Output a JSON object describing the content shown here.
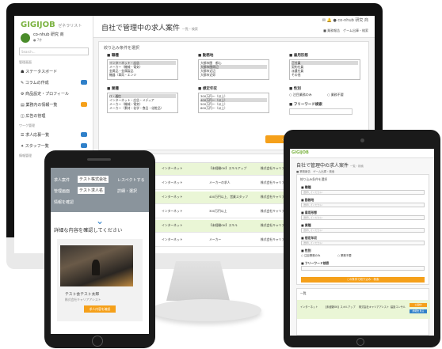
{
  "desktop": {
    "logo": "GIGIJOB",
    "logo_sub": "ゼネラリスト",
    "user_name": "co-nhub 研究 商",
    "user_sub": "● 7件",
    "search_placeholder": "Search...",
    "side_group_main": "管理画面",
    "side_group_work": "ワーク管理",
    "side_group_info": "情報管理",
    "sidebar_items": [
      {
        "label": "ステータスボード",
        "badge": ""
      },
      {
        "label": "コラムの作成",
        "badge": "blue"
      },
      {
        "label": "商品設定・プロフィール",
        "badge": ""
      },
      {
        "label": "業務内の情報一覧",
        "badge": "orange"
      },
      {
        "label": "広告の管理",
        "badge": ""
      },
      {
        "label": "求人応募一覧",
        "badge": "blue"
      },
      {
        "label": "スタッフ一覧",
        "badge": "blue"
      }
    ],
    "header_title": "自社で管理中の求人案件",
    "header_title_small": "一覧・検索",
    "header_icons": "✉ 🔔 ● co-nhub 研究 商",
    "header_right": "■ 業務報告　ゲーム出庫・検索",
    "panel_title": "絞り込み条件を選択",
    "filters": {
      "f1_label": "■ 職種",
      "f1_items": [
        "インターネット・広告",
        "メーカー（機械・電気）",
        "金属品・金属製品",
        "機器（車両・エンジ"
      ],
      "f2_label": "■ 勤務地",
      "f2_items": [
        "大都市圏　都心",
        "大都市圏周辺",
        "大都市近辺",
        "大都市近郊"
      ],
      "f3_label": "■ 雇用形態",
      "f3_items": [
        "正社員",
        "契約社員",
        "派遣社員",
        "その他"
      ],
      "f4_label": "■ 業種",
      "f4_items": [
        "IT・通信",
        "インターネット・広告・メディア",
        "メーカー（機械・電気）",
        "メーカー（素材・化学・食品・化粧品）"
      ],
      "f5_label": "■ 想定年収",
      "f5_items": [
        "300万円～（以上）",
        "400万円～（以上）",
        "500万円～（以上）",
        "600万円～（以上）"
      ],
      "f6_label": "■ 性別",
      "radio_a": "○ 注目業務のみ",
      "radio_b": "○ 業務不要",
      "freeword_label": "■ フリーワード検索",
      "search_button": "この条件で絞り込み・検索"
    },
    "results_header": "一覧",
    "rows": [
      {
        "c1": "インターネット",
        "c2": "【未経験OK】スキルアップ",
        "c3": "株式会社キャリアアシスト",
        "c4": "建設コンサル",
        "btn": "公開中"
      },
      {
        "c1": "インターネット",
        "c2": "メーカーの求人",
        "c3": "株式会社キャリアアシスト",
        "c4": "企業",
        "btn": "公開中"
      },
      {
        "c1": "インターネット",
        "c2": "400万円以上、営業スタッフ",
        "c3": "株式会社キャリアアシスト",
        "c4": "IT系",
        "btn": "公開中"
      },
      {
        "c1": "インターネット",
        "c2": "300万円以上",
        "c3": "株式会社キャリアアシスト",
        "c4": "販売スタッフ",
        "btn": "公開中"
      },
      {
        "c1": "インターネット",
        "c2": "【未経験OK】スキル",
        "c3": "株式会社キャリアアシスト",
        "c4": "建設コンサル",
        "btn": "公開中"
      },
      {
        "c1": "インターネット",
        "c2": "メーカー",
        "c3": "株式会社キャリアアシスト",
        "c4": "企業",
        "btn": "公開中"
      }
    ]
  },
  "phone": {
    "nav_items": [
      "求人案件",
      "テスト株式会社",
      "レスペクトする",
      "管理画面",
      "テスト求人名",
      "詳細・選択",
      "情報を確認"
    ],
    "heading": "詳細な内容を確認してください",
    "card_title": "テスト会テスト太郎",
    "card_sub": "株式会社キャリアアシスト",
    "card_button": "求人内容を確認"
  },
  "tablet": {
    "logo": "GIGIJOB",
    "title": "自社で管理中の求人案件",
    "title_small": "一覧・検索",
    "crumb": "■ 業務報告　ゲーム出庫・検索",
    "panel_title": "絞り込み条件を選択",
    "labels": [
      "■ 職種",
      "■ 勤務地",
      "■ 雇用形態",
      "■ 業種",
      "■ 想定年収",
      "■ 性別"
    ],
    "select_placeholder": "選択してください",
    "radio_a": "○ 注目業務のみ",
    "radio_b": "○ 業務不要",
    "freeword_label": "■ フリーワード検索",
    "search_button": "この条件で絞り込み・検索",
    "results_header": "一覧",
    "row": {
      "c1": "インターネット",
      "c2": "【未経験OK】スキルアップ",
      "c3": "株式会社キャリアアシスト",
      "c4": "建設コンサル",
      "btn1": "公開中",
      "btn2": "詳細を見る"
    }
  },
  "colors": {
    "accent_orange": "#f5a01a",
    "brand_green": "#7cb342",
    "row_green": "#eaf6d6",
    "badge_blue": "#2f80c9"
  }
}
